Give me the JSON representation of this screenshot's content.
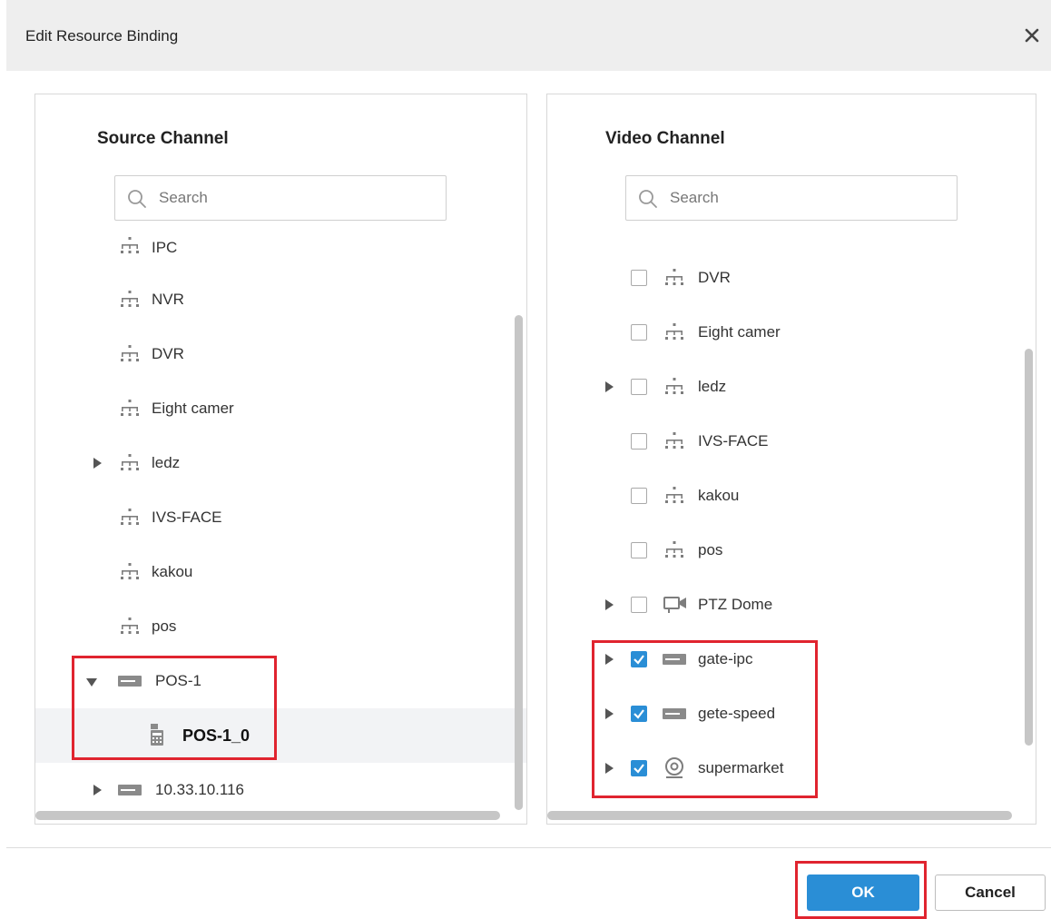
{
  "dialog": {
    "title": "Edit Resource Binding",
    "ok_label": "OK",
    "cancel_label": "Cancel"
  },
  "source_panel": {
    "title": "Source Channel",
    "search_placeholder": "Search",
    "partial_item_label": "IPC",
    "items": [
      {
        "label": "NVR",
        "icon": "device-tree-icon"
      },
      {
        "label": "DVR",
        "icon": "device-tree-icon"
      },
      {
        "label": "Eight camer",
        "icon": "device-tree-icon"
      },
      {
        "label": "ledz",
        "icon": "device-tree-icon",
        "expandable": true
      },
      {
        "label": "IVS-FACE",
        "icon": "device-tree-icon"
      },
      {
        "label": "kakou",
        "icon": "device-tree-icon"
      },
      {
        "label": "pos",
        "icon": "device-tree-icon"
      },
      {
        "label": "POS-1",
        "icon": "nvr-device-icon",
        "expanded": true
      },
      {
        "label": "POS-1_0",
        "icon": "pos-terminal-icon",
        "selected": true
      },
      {
        "label": "10.33.10.116",
        "icon": "nvr-device-icon",
        "expandable": true
      }
    ]
  },
  "video_panel": {
    "title": "Video Channel",
    "search_placeholder": "Search",
    "items": [
      {
        "label": "DVR",
        "icon": "device-tree-icon",
        "checked": false
      },
      {
        "label": "Eight camer",
        "icon": "device-tree-icon",
        "checked": false
      },
      {
        "label": "ledz",
        "icon": "device-tree-icon",
        "checked": false,
        "expandable": true
      },
      {
        "label": "IVS-FACE",
        "icon": "device-tree-icon",
        "checked": false
      },
      {
        "label": "kakou",
        "icon": "device-tree-icon",
        "checked": false
      },
      {
        "label": "pos",
        "icon": "device-tree-icon",
        "checked": false
      },
      {
        "label": "PTZ Dome",
        "icon": "camera-icon",
        "checked": false,
        "expandable": true
      },
      {
        "label": "gate-ipc",
        "icon": "nvr-device-icon",
        "checked": true,
        "expandable": true
      },
      {
        "label": "gete-speed",
        "icon": "nvr-device-icon",
        "checked": true,
        "expandable": true
      },
      {
        "label": "supermarket",
        "icon": "dome-camera-icon",
        "checked": true,
        "expandable": true
      }
    ]
  },
  "colors": {
    "accent": "#2a8ed6",
    "highlight": "#e0242f",
    "header_bg": "#eeeeee"
  }
}
